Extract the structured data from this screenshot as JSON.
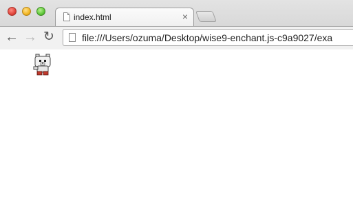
{
  "window": {
    "controls": [
      "close",
      "minimize",
      "maximize"
    ]
  },
  "tabs": [
    {
      "title": "index.html",
      "active": true
    }
  ],
  "tab_close_glyph": "×",
  "toolbar": {
    "back_icon": "back-arrow-icon",
    "forward_icon": "forward-arrow-icon",
    "reload_icon": "reload-icon"
  },
  "address_bar": {
    "url": "file:///Users/ozuma/Desktop/wise9-enchant.js-c9a9027/exa"
  },
  "content": {
    "sprite": "bear-sprite"
  }
}
